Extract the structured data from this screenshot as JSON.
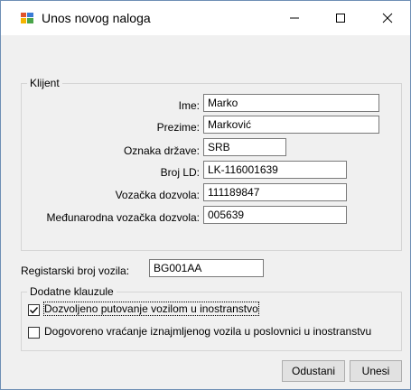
{
  "window": {
    "title": "Unos novog naloga",
    "icons": {
      "app": "form-app-icon",
      "minimize": "minimize-icon",
      "maximize": "maximize-icon",
      "close": "close-icon"
    }
  },
  "klijent": {
    "legend": "Klijent",
    "fields": {
      "ime": {
        "label": "Ime:",
        "value": "Marko"
      },
      "prezime": {
        "label": "Prezime:",
        "value": "Marković"
      },
      "oznaka_drzave": {
        "label": "Oznaka države:",
        "value": "SRB"
      },
      "broj_ld": {
        "label": "Broj LD:",
        "value": "LK-116001639"
      },
      "vozacka_dozvola": {
        "label": "Vozačka dozvola:",
        "value": "111189847"
      },
      "medjunarodna_dozvola": {
        "label": "Međunarodna vozačka dozvola:",
        "value": "005639"
      }
    }
  },
  "vozilo": {
    "registarski_broj": {
      "label": "Registarski broj vozila:",
      "value": "BG001AA"
    }
  },
  "dodatne_klauzule": {
    "legend": "Dodatne klauzule",
    "options": [
      {
        "label": "Dozvoljeno putovanje vozilom u inostranstvo",
        "checked": true
      },
      {
        "label": "Dogovoreno vraćanje iznajmljenog vozila u poslovnici u inostranstvu",
        "checked": false
      }
    ]
  },
  "buttons": {
    "cancel": "Odustani",
    "submit": "Unesi"
  },
  "colors": {
    "window_border": "#6e8fb5",
    "form_background": "#f0f0f0",
    "titlebar_background": "#ffffff"
  }
}
